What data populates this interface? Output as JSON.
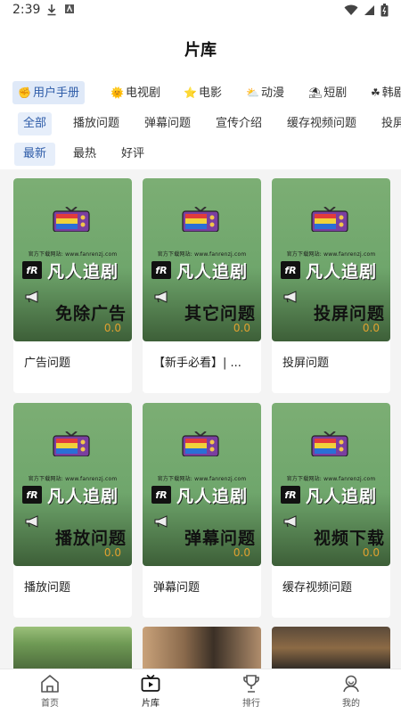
{
  "status": {
    "time": "2:39"
  },
  "header": {
    "title": "片库"
  },
  "categories": [
    {
      "label": "用户手册",
      "emoji": "✊",
      "active": true
    },
    {
      "label": "电视剧",
      "emoji": "🌞"
    },
    {
      "label": "电影",
      "emoji": "⭐"
    },
    {
      "label": "动漫",
      "emoji": "⛅"
    },
    {
      "label": "短剧",
      "emoji": "⛱"
    },
    {
      "label": "韩剧",
      "emoji": "☘"
    }
  ],
  "subcategories": [
    "全部",
    "播放问题",
    "弹幕问题",
    "宣传介绍",
    "缓存视频问题",
    "投屏"
  ],
  "sort": [
    "最新",
    "最热",
    "好评"
  ],
  "poster": {
    "site": "官方下载网站: www.fanrenzj.com",
    "brand": "凡人追剧",
    "logo": "fR"
  },
  "cards": [
    {
      "name": "广告问题",
      "big": "免除广告",
      "score": "0.0"
    },
    {
      "name": "【新手必看】| ...",
      "big": "其它问题",
      "score": "0.0"
    },
    {
      "name": "投屏问题",
      "big": "投屏问题",
      "score": "0.0"
    },
    {
      "name": "播放问题",
      "big": "播放问题",
      "score": "0.0"
    },
    {
      "name": "弹幕问题",
      "big": "弹幕问题",
      "score": "0.0"
    },
    {
      "name": "缓存视频问题",
      "big": "视频下载",
      "score": "0.0"
    }
  ],
  "tabbar": [
    {
      "label": "首页",
      "icon": "home-icon"
    },
    {
      "label": "片库",
      "icon": "tv-icon",
      "active": true
    },
    {
      "label": "排行",
      "icon": "trophy-icon"
    },
    {
      "label": "我的",
      "icon": "profile-icon"
    }
  ],
  "colors": {
    "accent": "#2e5ca8",
    "poster_green": "#7cae74",
    "score": "#e0a030"
  }
}
